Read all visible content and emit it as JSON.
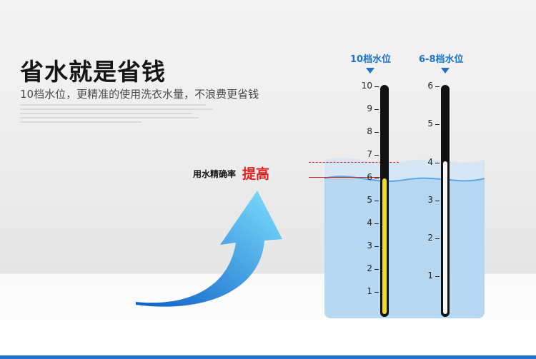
{
  "headline": "省水就是省钱",
  "subline": "10档水位，更精准的使用洗衣水量，不浪费更省钱",
  "accuracy": {
    "label": "用水精确率",
    "highlight": "提高"
  },
  "column_left": {
    "title": "10档水位",
    "ticks": [
      "10",
      "9",
      "8",
      "7",
      "6",
      "5",
      "4",
      "3",
      "2",
      "1"
    ],
    "level": 6
  },
  "column_right": {
    "title": "6-8档水位",
    "ticks": [
      "6",
      "5",
      "4",
      "3",
      "2",
      "1"
    ],
    "level": 4
  },
  "colors": {
    "accent": "#1a73c9",
    "highlight": "#e02020",
    "fill_yellow": "#f2e21a",
    "bottom_bar": "#1f6fc4"
  }
}
